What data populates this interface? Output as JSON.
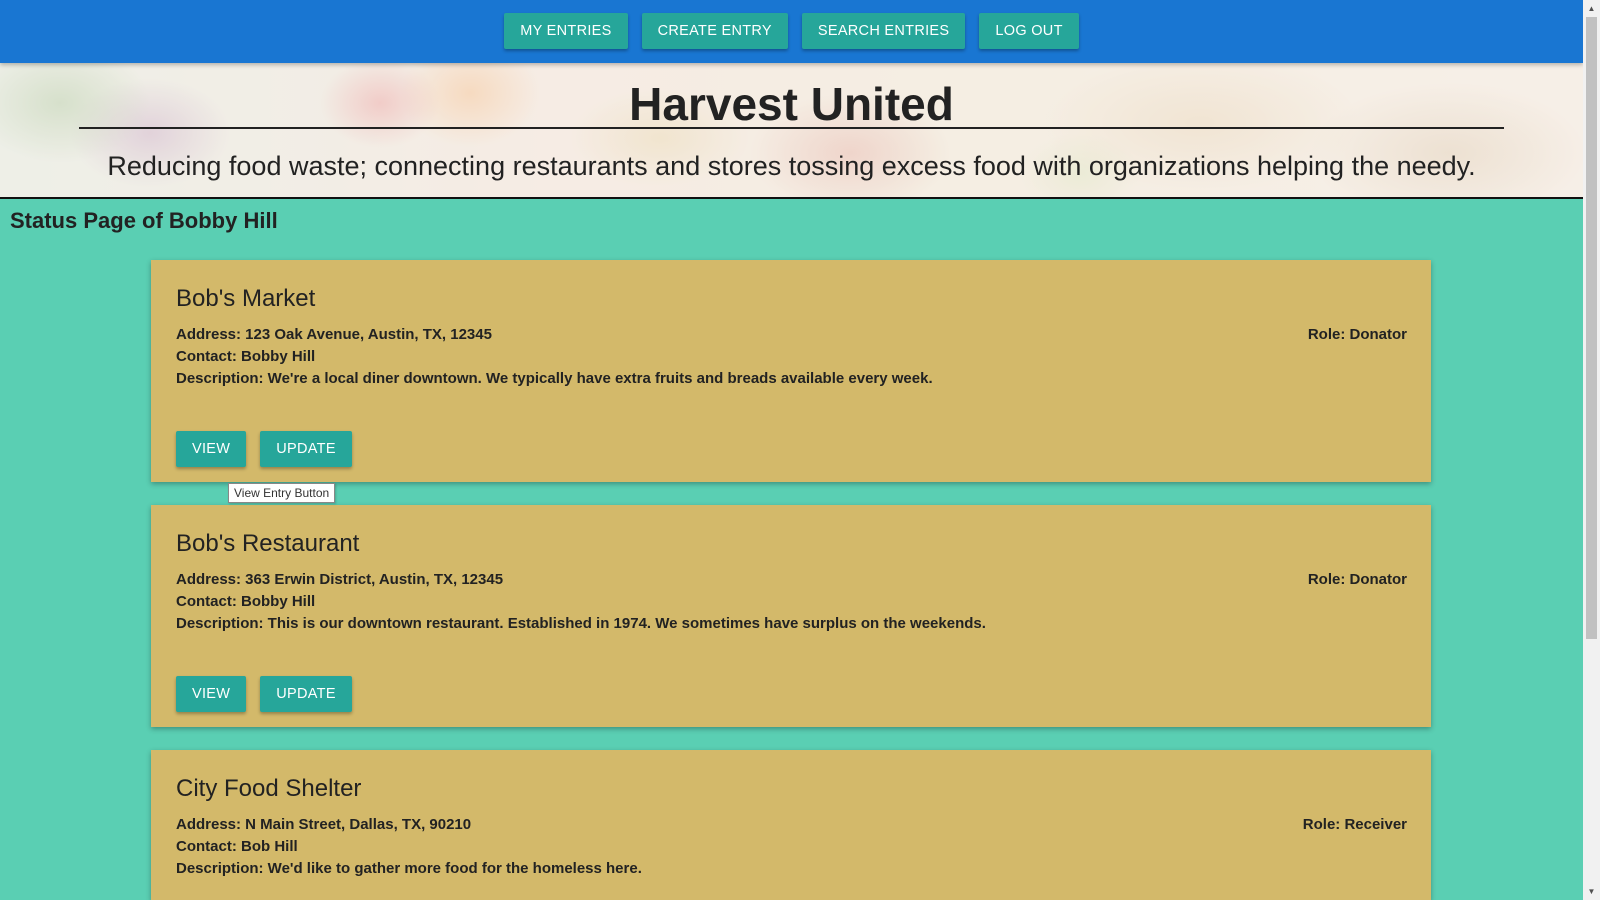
{
  "nav": {
    "my_entries": "MY ENTRIES",
    "create_entry": "CREATE ENTRY",
    "search_entries": "SEARCH ENTRIES",
    "log_out": "LOG OUT"
  },
  "hero": {
    "title": "Harvest United",
    "tagline": "Reducing food waste; connecting restaurants and stores tossing excess food with organizations helping the needy."
  },
  "status_title": "Status Page of Bobby Hill",
  "entries": [
    {
      "name": "Bob's Market",
      "address": "Address: 123 Oak Avenue, Austin, TX, 12345",
      "contact": "Contact: Bobby Hill",
      "description": "Description: We're a local diner downtown. We typically have extra fruits and breads available every week.",
      "role": "Role: Donator",
      "view_label": "VIEW",
      "update_label": "UPDATE"
    },
    {
      "name": "Bob's Restaurant",
      "address": "Address: 363 Erwin District, Austin, TX, 12345",
      "contact": "Contact: Bobby Hill",
      "description": "Description: This is our downtown restaurant. Established in 1974. We sometimes have surplus on the weekends.",
      "role": "Role: Donator",
      "view_label": "VIEW",
      "update_label": "UPDATE"
    },
    {
      "name": "City Food Shelter",
      "address": "Address: N Main Street, Dallas, TX, 90210",
      "contact": "Contact: Bob Hill",
      "description": "Description: We'd like to gather more food for the homeless here.",
      "role": "Role: Receiver"
    }
  ],
  "tooltip": "View Entry Button",
  "colors": {
    "nav_bg": "#1976d2",
    "button_bg": "#26a69a",
    "page_bg": "#5acfb3",
    "card_bg": "#d3b96a"
  },
  "icons": {
    "scroll_up": "scroll-up-arrow-icon",
    "scroll_down": "scroll-down-arrow-icon"
  }
}
